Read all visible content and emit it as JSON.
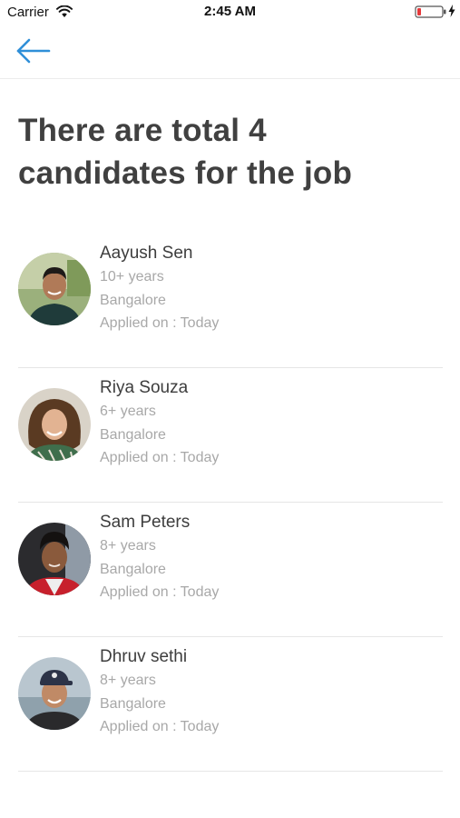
{
  "status_bar": {
    "carrier": "Carrier",
    "time": "2:45 AM"
  },
  "nav": {
    "back_icon": "arrow-left-icon",
    "accent_color": "#2f8fd8"
  },
  "title_line_1": "There are total 4",
  "title_line_2": "candidates for the job",
  "candidates": [
    {
      "name": "Aayush Sen",
      "experience": "10+ years",
      "location": "Bangalore",
      "applied": "Applied on : Today"
    },
    {
      "name": "Riya Souza",
      "experience": "6+ years",
      "location": "Bangalore",
      "applied": "Applied on : Today"
    },
    {
      "name": "Sam Peters",
      "experience": "8+ years",
      "location": "Bangalore",
      "applied": "Applied on : Today"
    },
    {
      "name": "Dhruv sethi",
      "experience": "8+ years",
      "location": "Bangalore",
      "applied": "Applied on : Today"
    }
  ]
}
